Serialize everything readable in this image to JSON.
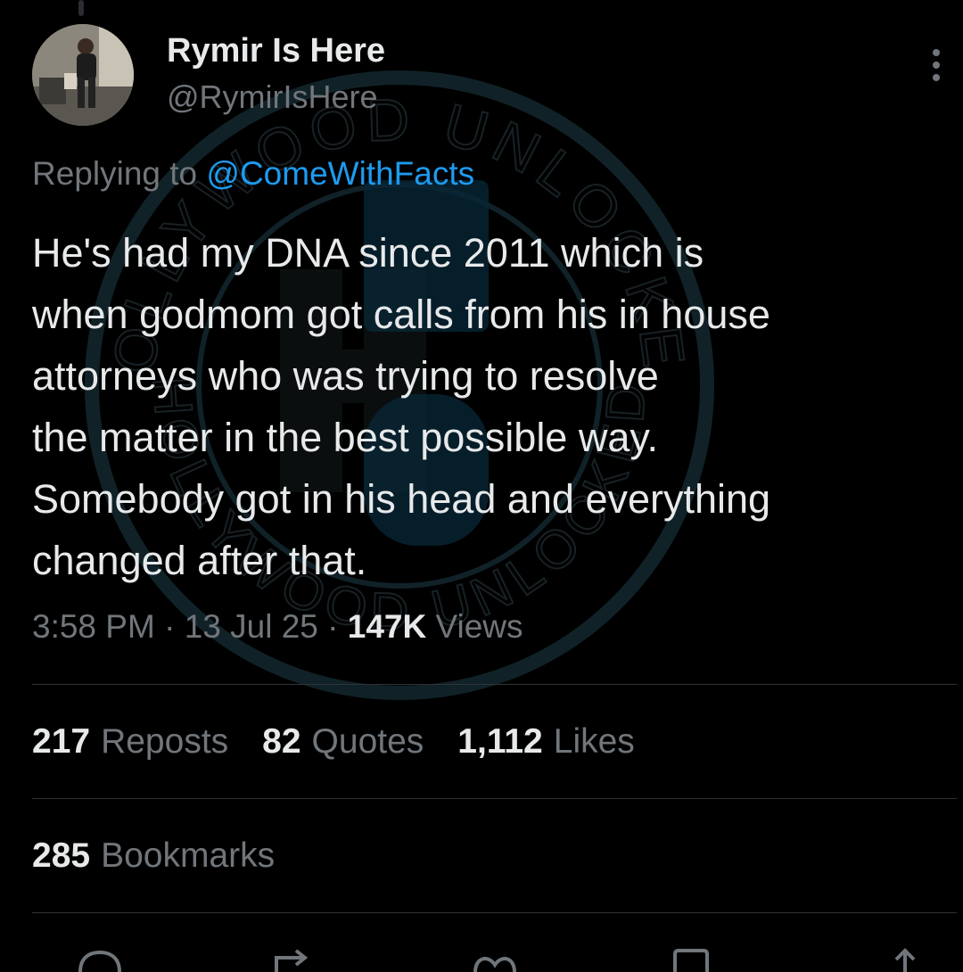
{
  "tweet": {
    "display_name": "Rymir Is Here",
    "handle": "@RymirIsHere",
    "replying_prefix": "Replying to",
    "replying_to": "@ComeWithFacts",
    "text_lines": [
      "He's had my DNA since 2011 which is",
      "when godmom got calls from his in house",
      "attorneys who was trying to resolve",
      "the matter in the best possible way.",
      "Somebody got in his head and everything",
      "changed after that."
    ],
    "time": "3:58 PM",
    "date": "13 Jul 25",
    "views_count": "147K",
    "views_label": "Views",
    "separator": "·"
  },
  "stats": {
    "reposts": {
      "count": "217",
      "label": "Reposts"
    },
    "quotes": {
      "count": "82",
      "label": "Quotes"
    },
    "likes": {
      "count": "1,112",
      "label": "Likes"
    },
    "bookmarks": {
      "count": "285",
      "label": "Bookmarks"
    }
  },
  "icons": {
    "more": "more-vertical-icon",
    "reply": "reply-icon",
    "repost": "repost-icon",
    "like": "heart-icon",
    "bookmark": "bookmark-icon",
    "share": "share-icon"
  },
  "watermark": {
    "text_top": "HOLLYWOOD UNLOCKED",
    "text_bottom": "HOLLYWOOD UNLOCKED"
  },
  "colors": {
    "background": "#000000",
    "text_primary": "#e7e9ea",
    "text_secondary": "#71767b",
    "accent": "#1d9bf0",
    "divider": "#2f3336"
  }
}
